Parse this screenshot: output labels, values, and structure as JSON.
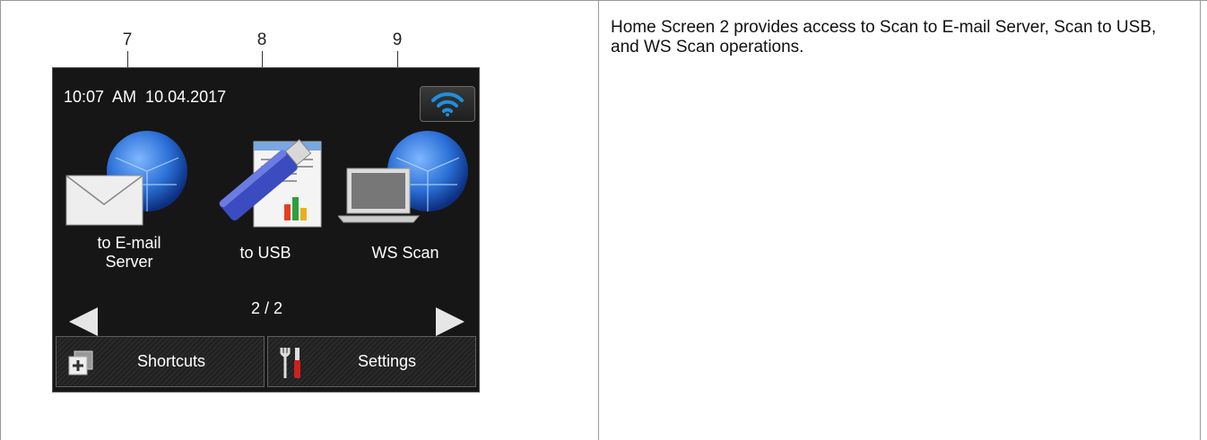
{
  "callouts": {
    "c7": "7",
    "c8": "8",
    "c9": "9"
  },
  "status_bar": {
    "time": "10:07  AM  10.04.2017",
    "wifi_icon": "wifi-icon"
  },
  "apps": [
    {
      "label": "to E-mail\nServer",
      "icon": "email-globe-icon"
    },
    {
      "label": "to USB",
      "icon": "usb-document-icon"
    },
    {
      "label": "WS Scan",
      "icon": "laptop-globe-icon"
    }
  ],
  "pager": {
    "current": "2 / 2",
    "prev_icon": "left-arrow-icon",
    "next_icon": "right-arrow-icon"
  },
  "bottom_bar": {
    "shortcuts_label": "Shortcuts",
    "settings_label": "Settings"
  },
  "description": "Home Screen 2 provides access to Scan to E-mail Server, Scan to USB, and WS Scan operations.",
  "colors": {
    "screen_bg": "#161616",
    "wifi_blue": "#1e8fe0",
    "globe_blue": "#2a6fd6",
    "usb_blue": "#3a4cc0"
  }
}
